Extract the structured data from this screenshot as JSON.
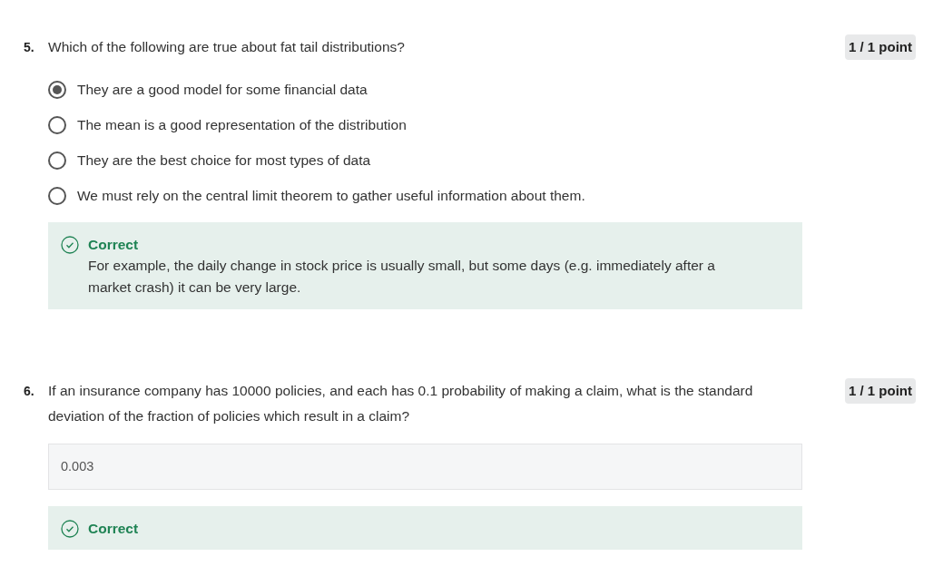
{
  "questions": [
    {
      "number": "5.",
      "prompt": "Which of the following are true about fat tail distributions?",
      "points": "1 / 1 point",
      "answer": {
        "kind": "choice",
        "options": [
          {
            "label": "They are a good model for some financial data",
            "selected": true
          },
          {
            "label": "The mean is a good representation of the distribution",
            "selected": false
          },
          {
            "label": "They are the best choice for most types of data",
            "selected": false
          },
          {
            "label": "We must rely on the central limit theorem to gather useful information about them.",
            "selected": false
          }
        ]
      },
      "feedback": {
        "kind": "correct",
        "label": "Correct",
        "explanation": "For example, the daily change in stock price is usually small, but some days (e.g. immediately after a market crash) it can be very large."
      }
    },
    {
      "number": "6.",
      "prompt": "If an insurance company has 10000 policies, and each has 0.1 probability of making a claim, what is the standard deviation of the fraction of policies which result in a claim?",
      "points": "1 / 1 point",
      "answer": {
        "kind": "text",
        "value": "0.003"
      },
      "feedback": {
        "kind": "correct",
        "label": "Correct"
      }
    }
  ]
}
